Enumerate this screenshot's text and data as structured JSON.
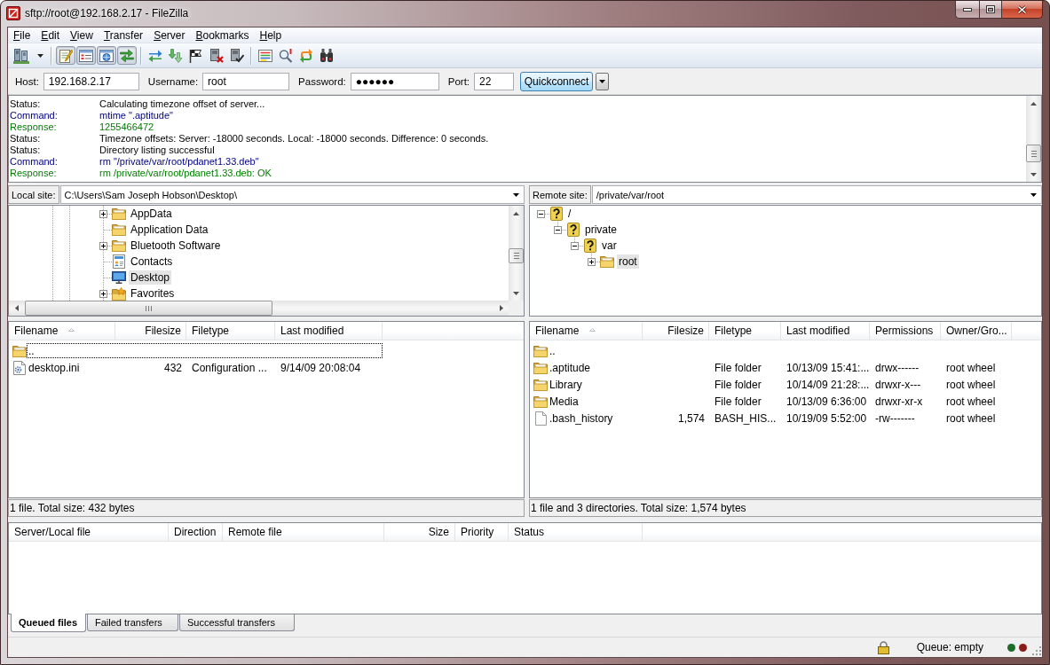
{
  "window": {
    "title": "sftp://root@192.168.2.17 - FileZilla"
  },
  "menu": [
    "File",
    "Edit",
    "View",
    "Transfer",
    "Server",
    "Bookmarks",
    "Help"
  ],
  "toolbar": {
    "toggles": [
      {
        "on": true
      },
      {
        "on": true
      },
      {
        "on": true
      },
      {
        "on": true
      }
    ]
  },
  "quickconnect": {
    "fields": [
      {
        "label": "Host:",
        "value": "192.168.2.17"
      },
      {
        "label": "Username:",
        "value": "root"
      },
      {
        "label": "Password:",
        "value": "●●●●●●"
      },
      {
        "label": "Port:",
        "value": "22"
      }
    ],
    "button": "Quickconnect"
  },
  "message_log": [
    {
      "kind": "status",
      "label": "Status:",
      "text": "Calculating timezone offset of server..."
    },
    {
      "kind": "command",
      "label": "Command:",
      "text": "mtime \".aptitude\""
    },
    {
      "kind": "response",
      "label": "Response:",
      "text": "1255466472"
    },
    {
      "kind": "status",
      "label": "Status:",
      "text": "Timezone offsets: Server: -18000 seconds. Local: -18000 seconds. Difference: 0 seconds."
    },
    {
      "kind": "status",
      "label": "Status:",
      "text": "Directory listing successful"
    },
    {
      "kind": "command",
      "label": "Command:",
      "text": "rm \"/private/var/root/pdanet1.33.deb\""
    },
    {
      "kind": "response",
      "label": "Response:",
      "text": "rm /private/var/root/pdanet1.33.deb: OK"
    }
  ],
  "local_site": {
    "label": "Local site:",
    "path": "C:\\Users\\Sam Joseph Hobson\\Desktop\\",
    "tree": [
      {
        "label": "AppData",
        "kind": "folder",
        "expanded": false,
        "selected": false
      },
      {
        "label": "Application Data",
        "kind": "folder",
        "selected": false
      },
      {
        "label": "Bluetooth Software",
        "kind": "folder",
        "expanded": false,
        "selected": false
      },
      {
        "label": "Contacts",
        "kind": "contacts",
        "selected": false
      },
      {
        "label": "Desktop",
        "kind": "desktop",
        "selected": true
      },
      {
        "label": "Favorites",
        "kind": "favorites",
        "expanded": false,
        "selected": false
      }
    ]
  },
  "remote_site": {
    "label": "Remote site:",
    "path": "/private/var/root",
    "tree": [
      {
        "label": "/",
        "kind": "unknown",
        "expanded": true,
        "selected": false,
        "children": [
          {
            "label": "private",
            "kind": "unknown",
            "expanded": true,
            "selected": false,
            "children": [
              {
                "label": "var",
                "kind": "unknown",
                "expanded": true,
                "selected": false,
                "children": [
                  {
                    "label": "root",
                    "kind": "folder",
                    "expanded": false,
                    "selected": true
                  }
                ]
              }
            ]
          }
        ]
      }
    ]
  },
  "local_files": {
    "columns": [
      {
        "label": "Filename",
        "sorted": true
      },
      {
        "label": "Filesize",
        "sorted": false
      },
      {
        "label": "Filetype",
        "sorted": false
      },
      {
        "label": "Last modified",
        "sorted": false
      }
    ],
    "rows": [
      {
        "kind": "folder",
        "name": "..",
        "focused": true
      },
      {
        "kind": "config",
        "name": "desktop.ini",
        "size": "432",
        "type": "Configuration ...",
        "modified": "9/14/09 20:08:04",
        "focused": false
      }
    ],
    "status": "1 file. Total size: 432 bytes"
  },
  "remote_files": {
    "columns": [
      {
        "label": "Filename",
        "sorted": true
      },
      {
        "label": "Filesize",
        "sorted": false
      },
      {
        "label": "Filetype",
        "sorted": false
      },
      {
        "label": "Last modified",
        "sorted": false
      },
      {
        "label": "Permissions",
        "sorted": false
      },
      {
        "label": "Owner/Gro...",
        "sorted": false
      }
    ],
    "rows": [
      {
        "kind": "folder",
        "name": "..",
        "focused": false
      },
      {
        "kind": "folder",
        "name": ".aptitude",
        "type": "File folder",
        "modified": "10/13/09 15:41:...",
        "permissions": "drwx------",
        "owner": "root wheel",
        "focused": false
      },
      {
        "kind": "folder",
        "name": "Library",
        "type": "File folder",
        "modified": "10/14/09 21:28:...",
        "permissions": "drwxr-x---",
        "owner": "root wheel",
        "focused": false
      },
      {
        "kind": "folder",
        "name": "Media",
        "type": "File folder",
        "modified": "10/13/09 6:36:00",
        "permissions": "drwxr-xr-x",
        "owner": "root wheel",
        "focused": false
      },
      {
        "kind": "file",
        "name": ".bash_history",
        "size": "1,574",
        "type": "BASH_HIS...",
        "modified": "10/19/09 5:52:00",
        "permissions": "-rw-------",
        "owner": "root wheel",
        "focused": false
      }
    ],
    "status": "1 file and 3 directories. Total size: 1,574 bytes"
  },
  "queue": {
    "columns": [
      "Server/Local file",
      "Direction",
      "Remote file",
      "Size",
      "Priority",
      "Status"
    ],
    "tabs": [
      {
        "label": "Queued files",
        "selected": true
      },
      {
        "label": "Failed transfers",
        "selected": false
      },
      {
        "label": "Successful transfers",
        "selected": false
      }
    ]
  },
  "status_bar": {
    "queue": "Queue: empty",
    "indicators": [
      {
        "color": "#1e6b2a"
      },
      {
        "color": "#8a1c1c"
      }
    ]
  }
}
